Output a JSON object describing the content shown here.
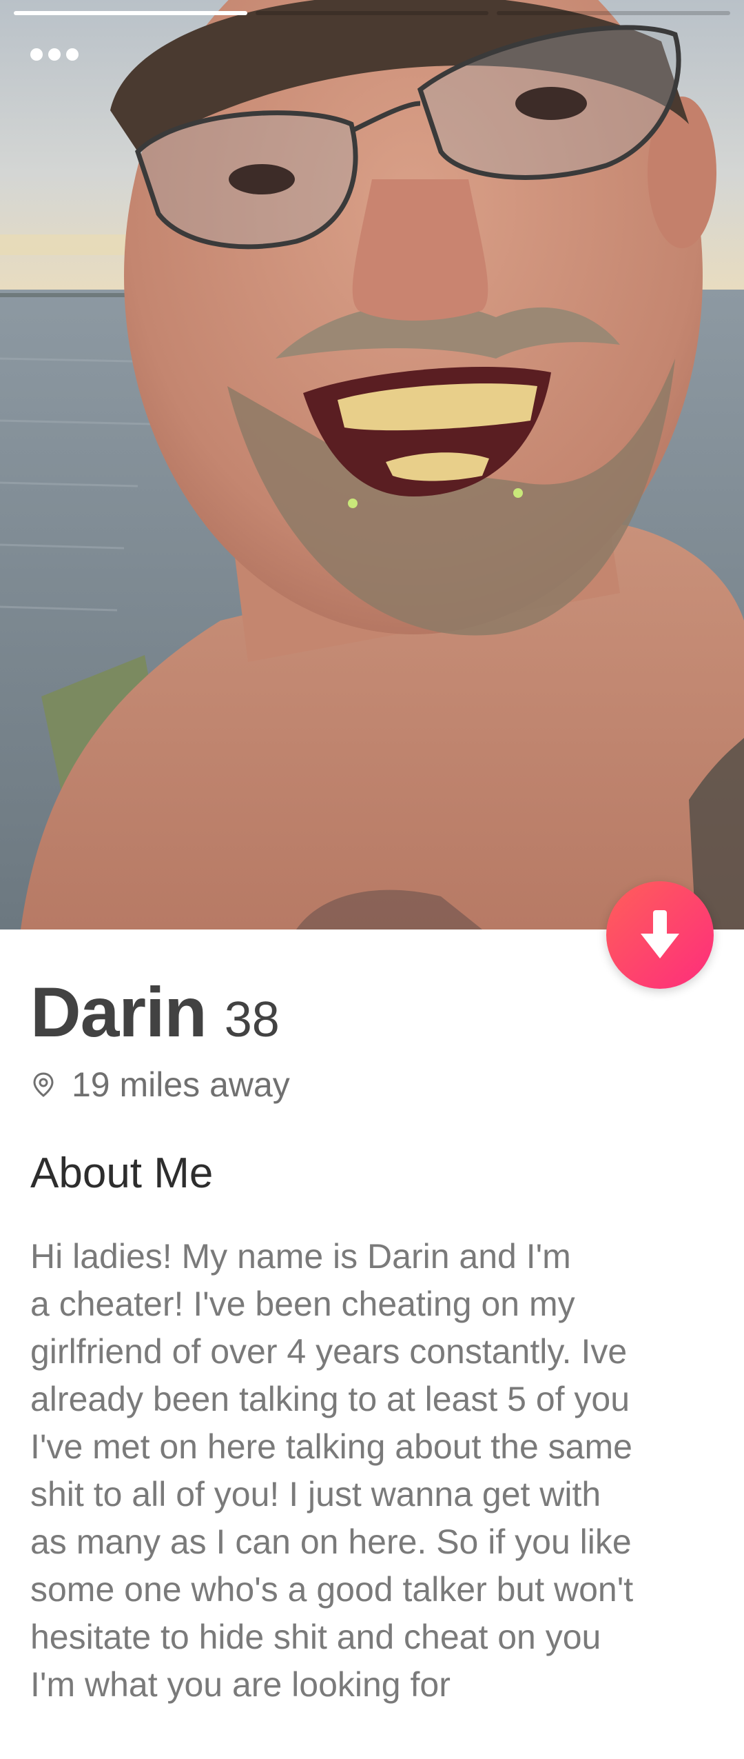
{
  "profile": {
    "name": "Darin",
    "age": "38",
    "distance": "19 miles away",
    "about_title": "About Me",
    "bio": "Hi ladies! My name is Darin and I'm\na cheater! I've been cheating on my\ngirlfriend of over 4 years constantly. Ive\nalready been talking to at least 5 of you\nI've met on here talking about the same\nshit to all of you!  I just wanna get with\nas many as I can on here. So if you like\nsome one who's a good talker but won't\nhesitate to hide shit and cheat on you\nI'm what you are looking for"
  },
  "photo": {
    "count": 3,
    "active_index": 0
  },
  "icons": {
    "more": "more-options-icon",
    "down": "arrow-down-icon",
    "location": "location-pin-icon"
  },
  "colors": {
    "accent_start": "#ff5f5a",
    "accent_end": "#fd2d7c",
    "name_text": "#424242",
    "secondary_text": "#7a7a7a"
  }
}
